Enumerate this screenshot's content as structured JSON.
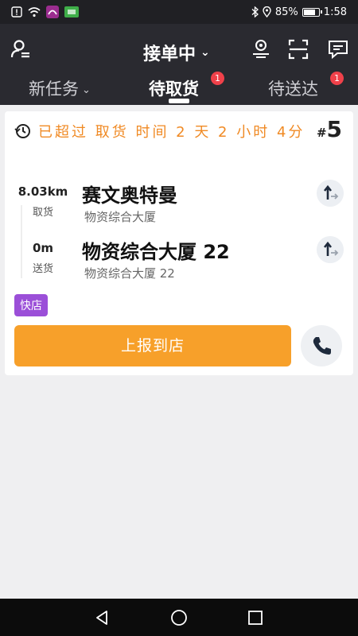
{
  "status_bar": {
    "battery": "85%",
    "battery_level": 0.85,
    "time": "1:58",
    "icons": [
      "alert-icon",
      "wifi-icon",
      "app-notification-icon",
      "sim-icon",
      "bluetooth-icon",
      "location-icon",
      "battery-icon"
    ]
  },
  "header": {
    "work_status": "接单中",
    "icons": [
      "rider-icon",
      "location-pin-icon",
      "scan-icon",
      "message-icon"
    ]
  },
  "tabs": [
    {
      "label": "新任务",
      "badge": ""
    },
    {
      "label": "待取货",
      "badge": "1"
    },
    {
      "label": "待送达",
      "badge": "1"
    }
  ],
  "order": {
    "overdue_text": "已超过 取货 时间 2 天 2 小时 4分",
    "number_prefix": "#",
    "number": "5",
    "pickup": {
      "distance": "8.03km",
      "type": "取货",
      "name": "赛文奥特曼",
      "address": "物资综合大厦"
    },
    "delivery": {
      "distance": "0m",
      "type": "送货",
      "name": "物资综合大厦 22",
      "address": "物资综合大厦 22"
    },
    "tag": "快店",
    "action_label": "上报到店"
  },
  "colors": {
    "accent": "#f7a02a",
    "overdue": "#f08a24",
    "badge": "#f0414a",
    "tag": "#9b4fd8",
    "header_bg": "#2a2a30"
  }
}
